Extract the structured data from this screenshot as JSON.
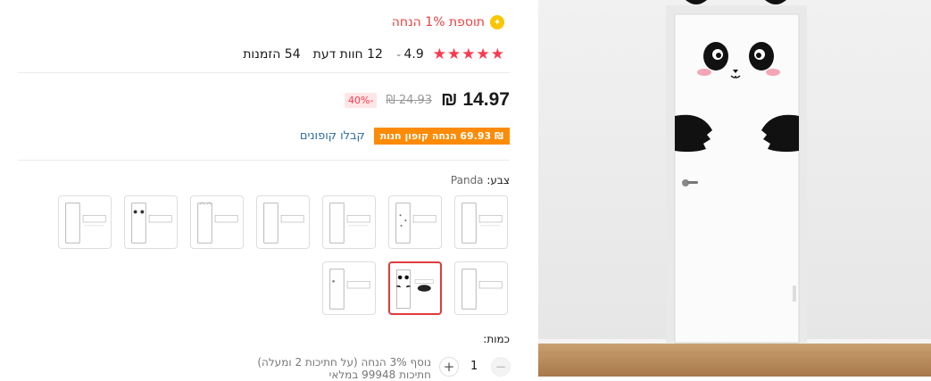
{
  "bonus": {
    "text": "תוספת 1% הנחה"
  },
  "rating": {
    "stars": 5,
    "value": "4.9",
    "reviews_label": "12 חוות דעת",
    "orders_label": "54 הזמנות"
  },
  "price": {
    "current": "14.97 ₪",
    "original": "24.93 ₪",
    "discount": "-40%"
  },
  "coupon": {
    "tag": "₪ 69.93 הנחה קופון חנות",
    "link": "קבלו קופונים"
  },
  "color": {
    "label": "צבע:",
    "value": "Panda",
    "selected_index": 8
  },
  "quantity": {
    "label": "כמות:",
    "value": "1",
    "note_line1": "נוסף 3% הנחה (על חתיכות 2 ומעלה)",
    "note_line2": "חתיכות 99948 במלאי"
  },
  "colors": {
    "accent": "#fd384f",
    "coupon": "#fd8b06",
    "link": "#2d6c9e",
    "bonus_text": "#e8403f"
  }
}
